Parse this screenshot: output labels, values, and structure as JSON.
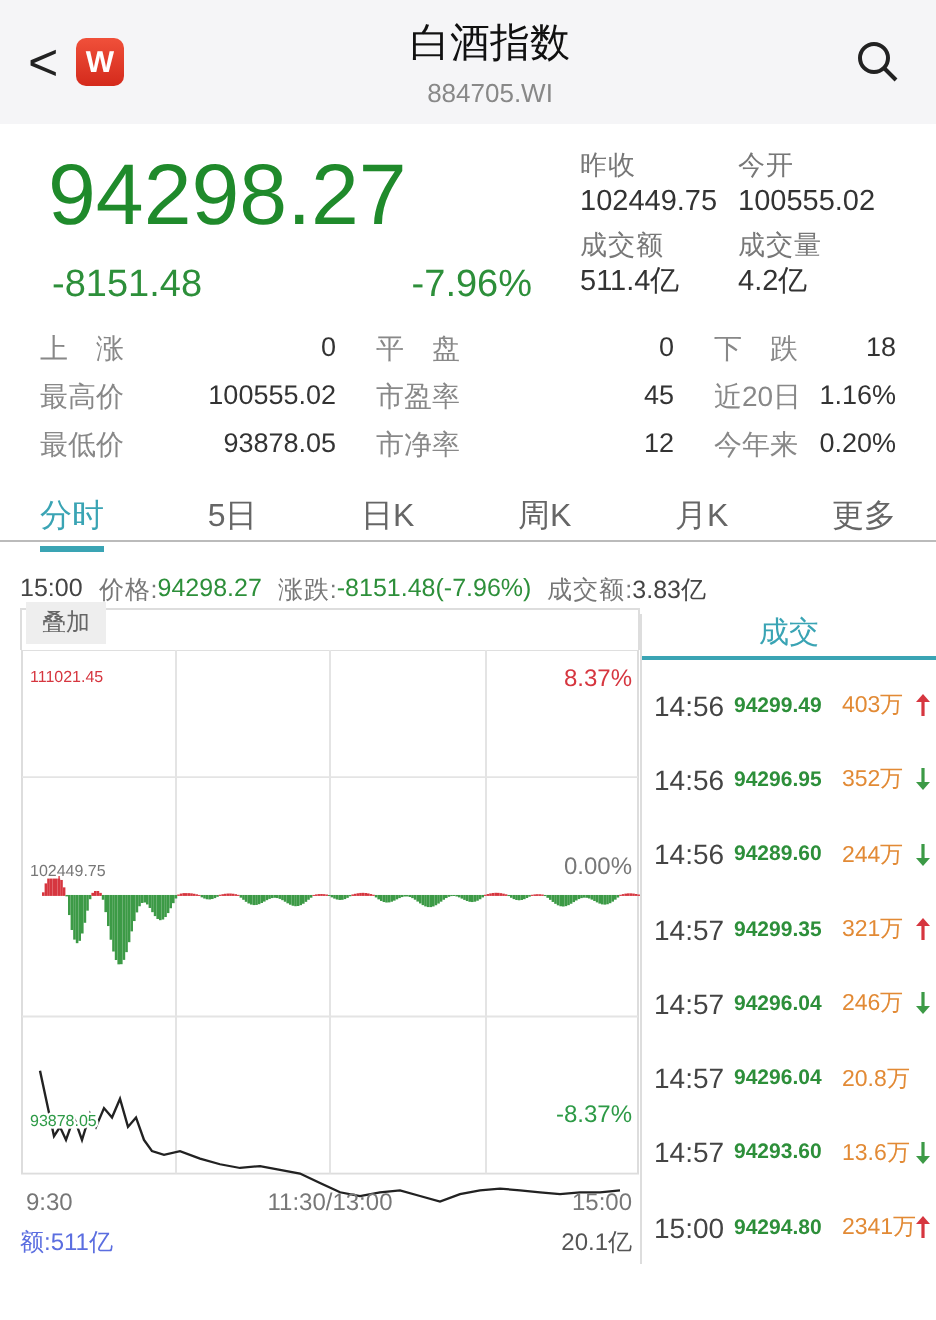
{
  "header": {
    "back": "<",
    "logo": "W",
    "title": "白酒指数",
    "code": "884705.WI"
  },
  "quote": {
    "price": "94298.27",
    "change": "-8151.48",
    "change_pct": "-7.96%",
    "stats": [
      {
        "label": "昨收",
        "value": "102449.75"
      },
      {
        "label": "今开",
        "value": "100555.02"
      },
      {
        "label": "成交额",
        "value": "511.4亿"
      },
      {
        "label": "成交量",
        "value": "4.2亿"
      }
    ]
  },
  "details": [
    {
      "label": "上　涨",
      "value": "0"
    },
    {
      "label": "平　盘",
      "value": "0"
    },
    {
      "label": "下　跌",
      "value": "18"
    },
    {
      "label": "最高价",
      "value": "100555.02"
    },
    {
      "label": "市盈率",
      "value": "45"
    },
    {
      "label": "近20日",
      "value": "1.16%"
    },
    {
      "label": "最低价",
      "value": "93878.05"
    },
    {
      "label": "市净率",
      "value": "12"
    },
    {
      "label": "今年来",
      "value": "0.20%"
    }
  ],
  "tabs": [
    {
      "label": "分时",
      "selected": true
    },
    {
      "label": "5日",
      "selected": false
    },
    {
      "label": "日K",
      "selected": false
    },
    {
      "label": "周K",
      "selected": false
    },
    {
      "label": "月K",
      "selected": false
    },
    {
      "label": "更多",
      "selected": false
    }
  ],
  "info_bar": {
    "time": "15:00",
    "price_label": "价格:",
    "price": "94298.27",
    "change_label": "涨跌:",
    "change": "-8151.48(-7.96%)",
    "amount_label": "成交额:",
    "amount": "3.83亿"
  },
  "chart": {
    "overlay_button": "叠加",
    "high": "111021.45",
    "high_pct": "8.37%",
    "base": "102449.75",
    "base_pct": "0.00%",
    "low": "93878.05",
    "low_pct": "-8.37%",
    "x_labels": [
      "9:30",
      "11:30/13:00",
      "15:00"
    ],
    "volume_label": "额:511亿",
    "volume_max": "20.1亿"
  },
  "trades": {
    "title": "成交",
    "rows": [
      {
        "time": "14:56",
        "price": "94299.49",
        "volume": "403万",
        "kind": "up"
      },
      {
        "time": "14:56",
        "price": "94296.95",
        "volume": "352万",
        "kind": "down"
      },
      {
        "time": "14:56",
        "price": "94289.60",
        "volume": "244万",
        "kind": "down"
      },
      {
        "time": "14:57",
        "price": "94299.35",
        "volume": "321万",
        "kind": "up"
      },
      {
        "time": "14:57",
        "price": "94296.04",
        "volume": "246万",
        "kind": "down"
      },
      {
        "time": "14:57",
        "price": "94296.04",
        "volume": "20.8万",
        "kind": "plain"
      },
      {
        "time": "14:57",
        "price": "94293.60",
        "volume": "13.6万",
        "kind": "down"
      },
      {
        "time": "15:00",
        "price": "94294.80",
        "volume": "2341万",
        "kind": "up"
      }
    ]
  }
}
